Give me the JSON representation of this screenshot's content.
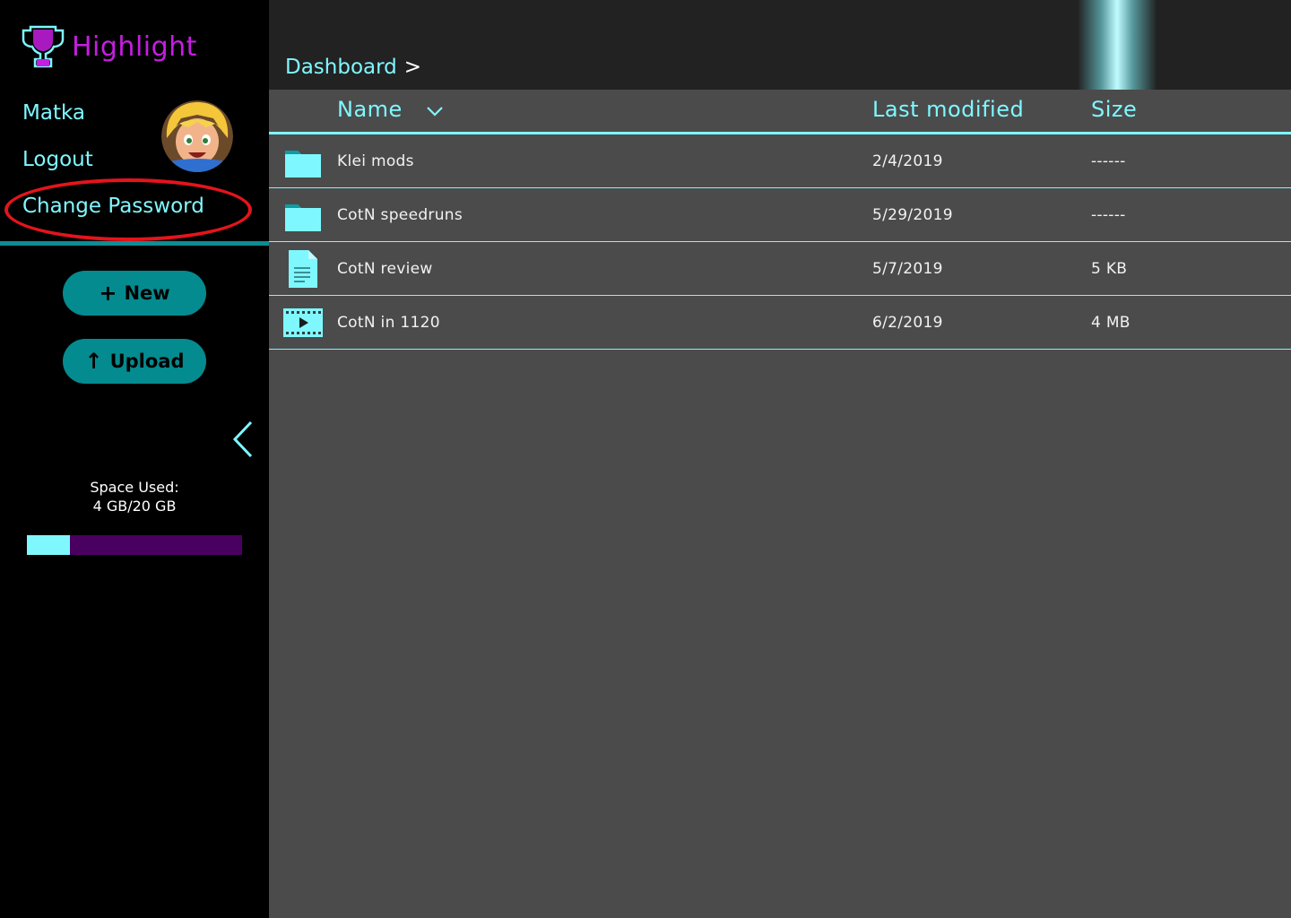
{
  "app": {
    "name": "Highlight",
    "logo_icon": "trophy-icon"
  },
  "user": {
    "name": "Matka",
    "logout_label": "Logout",
    "change_password_label": "Change Password",
    "avatar_icon": "avatar"
  },
  "actions": {
    "new_label": "New",
    "new_icon": "plus-icon",
    "upload_label": "Upload",
    "upload_icon": "arrow-up-icon"
  },
  "storage": {
    "label": "Space Used:",
    "value": "4 GB/20 GB",
    "used_fraction": 0.2
  },
  "breadcrumb": {
    "items": [
      "Dashboard"
    ],
    "separator": ">"
  },
  "table": {
    "columns": {
      "name": "Name",
      "modified": "Last modified",
      "size": "Size"
    },
    "rows": [
      {
        "type": "folder",
        "icon": "folder-icon",
        "name": "Klei mods",
        "modified": "2/4/2019",
        "size": "------"
      },
      {
        "type": "folder",
        "icon": "folder-icon",
        "name": "CotN speedruns",
        "modified": "5/29/2019",
        "size": "------"
      },
      {
        "type": "document",
        "icon": "document-icon",
        "name": "CotN review",
        "modified": "5/7/2019",
        "size": "5 KB"
      },
      {
        "type": "video",
        "icon": "video-icon",
        "name": "CotN in 1120",
        "modified": "6/2/2019",
        "size": "4 MB"
      }
    ]
  },
  "colors": {
    "accent": "#7ff7ff",
    "brand": "#c51ee0",
    "button": "#048b8f",
    "highlight_ring": "#e4141c",
    "storage_track": "#4a0060"
  }
}
